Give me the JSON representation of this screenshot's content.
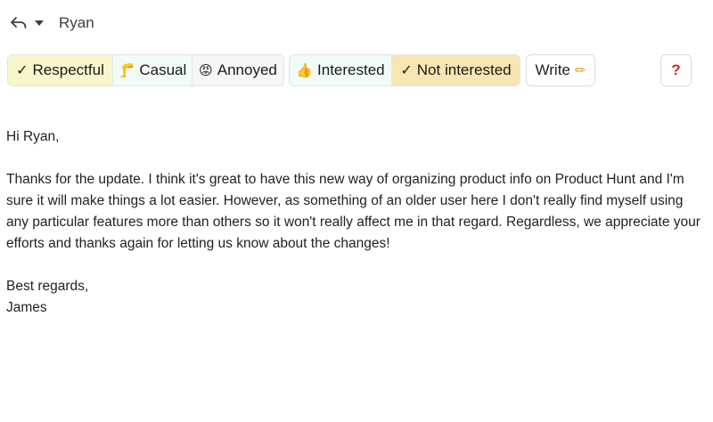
{
  "header": {
    "recipient": "Ryan",
    "reply_icon": "reply-icon",
    "dropdown_icon": "caret-down-icon"
  },
  "toolbar": {
    "tone_group": [
      {
        "label": "Respectful",
        "prefix": "✓",
        "selected": true
      },
      {
        "label": "Casual",
        "prefix": "🦵",
        "selected": false
      },
      {
        "label": "Annoyed",
        "prefix": "😡",
        "selected": false
      }
    ],
    "interest_group": [
      {
        "label": "Interested",
        "prefix": "👍",
        "selected": false
      },
      {
        "label": "Not interested",
        "prefix": "✓",
        "selected": true
      }
    ],
    "write_label": "Write",
    "write_icon": "pencil-icon",
    "help_label": "?",
    "colors": {
      "respectful_bg": "#f8f7cb",
      "casual_bg": "#f2fbf8",
      "annoyed_bg": "#f6f6f6",
      "interested_bg": "#f2fbf8",
      "not_interested_bg": "#f7e6b1",
      "help_color": "#d42b1e"
    }
  },
  "email": {
    "greeting": "Hi Ryan,",
    "paragraph": "Thanks for the update. I think it's great to have this new way of organizing product info on Product Hunt and I'm sure it will make things a lot easier. However, as something of an older user here I don't really find myself using any particular features more than others so it won't really affect me in that regard. Regardless, we appreciate your efforts and thanks again for letting us know about the changes!",
    "closing": "Best regards,",
    "signature": "James"
  }
}
